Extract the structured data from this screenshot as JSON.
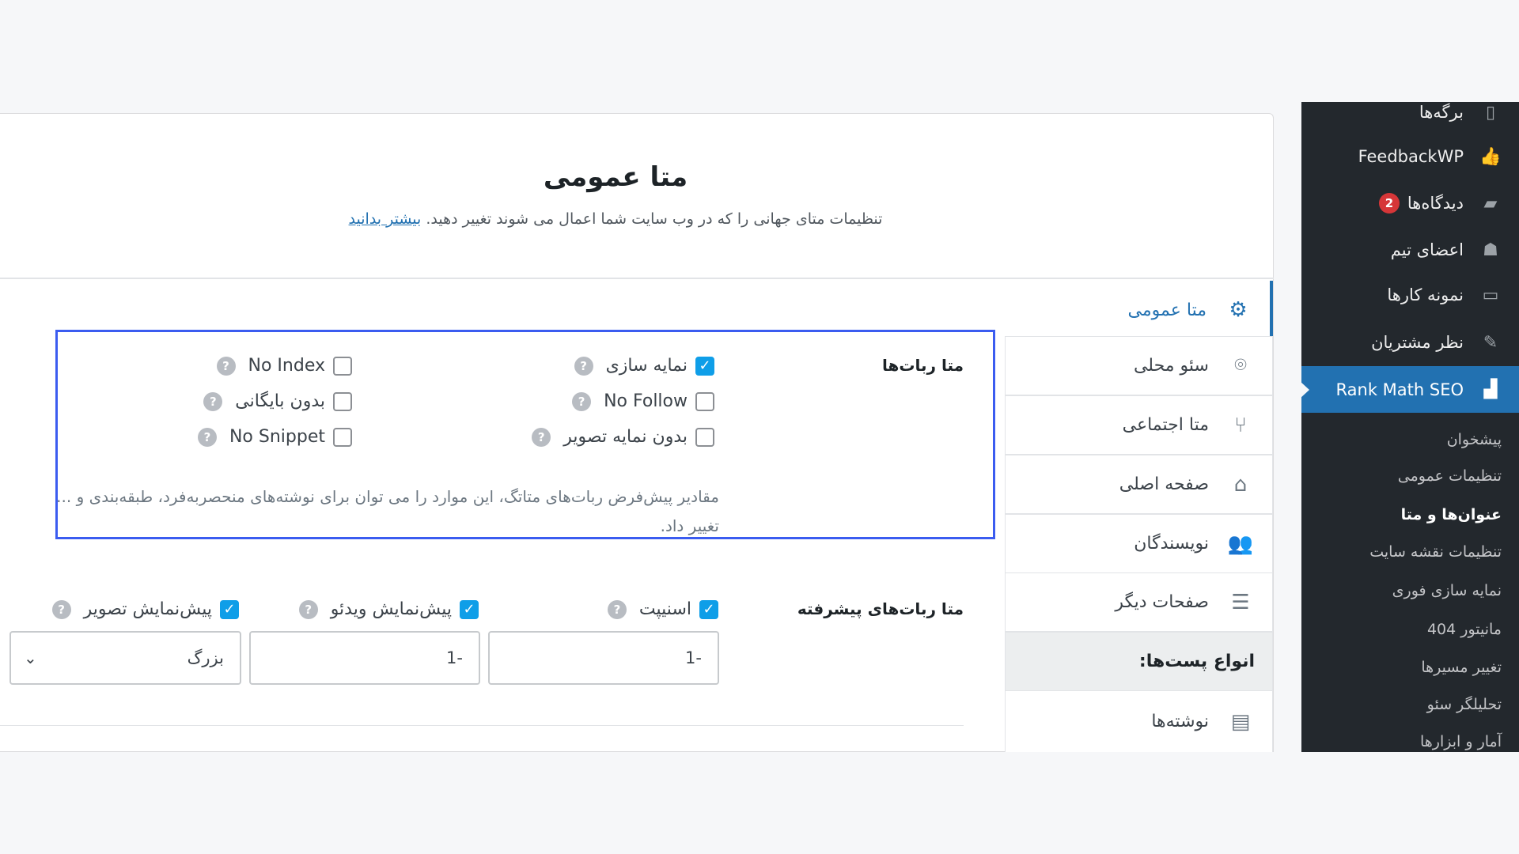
{
  "sidebar": {
    "items": [
      {
        "label": "برگه‌ها",
        "icon": "pages-icon"
      },
      {
        "label": "FeedbackWP",
        "icon": "thumbs-up-icon"
      },
      {
        "label": "دیدگاه‌ها",
        "icon": "comment-icon",
        "badge": "2"
      },
      {
        "label": "اعضای تیم",
        "icon": "team-icon"
      },
      {
        "label": "نمونه کارها",
        "icon": "folder-icon"
      },
      {
        "label": "نظر مشتریان",
        "icon": "pin-icon"
      }
    ],
    "active": {
      "label": "Rank Math SEO",
      "icon": "rank-math-icon"
    },
    "submenu": [
      "پیشخوان",
      "تنظیمات عمومی",
      "عنوان‌ها و متا",
      "تنظیمات نقشه سایت",
      "نمایه سازی فوری",
      "مانیتور 404",
      "تغییر مسیرها",
      "تحلیلگر سئو",
      "آمار و ابزارها"
    ],
    "current_sub": "عنوان‌ها و متا"
  },
  "header": {
    "title": "متا عمومی",
    "subtitle": "تنظیمات متای جهانی را که در وب سایت شما اعمال می شوند تغییر دهید.",
    "learn_more": "بیشتر بدانید"
  },
  "tabs": [
    {
      "label": "متا عمومی",
      "icon": "gear-icon",
      "active": true
    },
    {
      "label": "سئو محلی",
      "icon": "location-pin-icon"
    },
    {
      "label": "متا اجتماعی",
      "icon": "share-icon"
    },
    {
      "label": "صفحه اصلی",
      "icon": "home-icon"
    },
    {
      "label": "نویسندگان",
      "icon": "users-icon"
    },
    {
      "label": "صفحات دیگر",
      "icon": "list-icon"
    },
    {
      "label": "انواع پست‌ها:",
      "header": true
    },
    {
      "label": "نوشته‌ها",
      "icon": "post-icon"
    }
  ],
  "robots": {
    "label": "متا ربات‌ها",
    "options": [
      {
        "label": "نمایه سازی",
        "checked": true
      },
      {
        "label": "No Index",
        "checked": false
      },
      {
        "label": "No Follow",
        "checked": false
      },
      {
        "label": "بدون بایگانی",
        "checked": false
      },
      {
        "label": "بدون نمایه تصویر",
        "checked": false
      },
      {
        "label": "No Snippet",
        "checked": false
      }
    ],
    "description": "مقادیر پیش‌فرض ربات‌های متاتگ، این موارد را می توان برای نوشته‌های منحصربه‌فرد، طبقه‌بندی و ... تغییر داد."
  },
  "advanced": {
    "label": "متا ربات‌های پیشرفته",
    "options": [
      {
        "label": "اسنیپت",
        "checked": true
      },
      {
        "label": "پیش‌نمایش ویدئو",
        "checked": true
      },
      {
        "label": "پیش‌نمایش تصویر",
        "checked": true
      }
    ],
    "snippet_value": "-1",
    "video_value": "-1",
    "image_value": "بزرگ"
  },
  "colors": {
    "accent": "#2271b1",
    "highlight_box": "#3b5cf0",
    "checkbox": "#0f9ee8",
    "admin_bar": "#23282d"
  }
}
